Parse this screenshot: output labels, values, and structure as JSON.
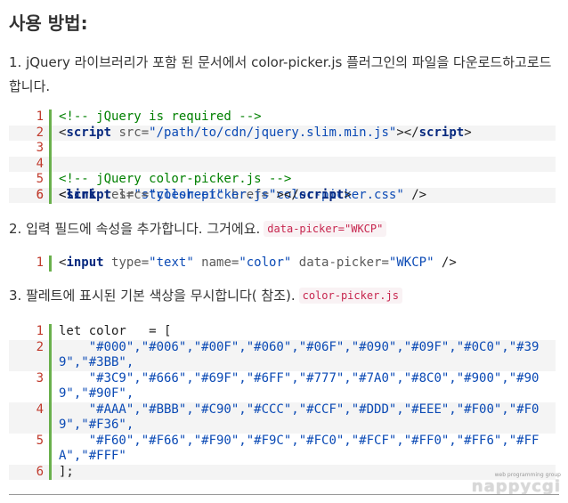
{
  "heading": "사용 방법:",
  "step1": "1. jQuery 라이브러리가 포함 된 문서에서 color-picker.js 플러그인의 파일을 다운로드하고로드합니다.",
  "step2": {
    "text": "2. 입력 필드에 속성을 추가합니다. 그거에요.",
    "code": "data-picker=\"WKCP\""
  },
  "step3": {
    "text": "3. 팔레트에 표시된 기본 색상을 무시합니다( 참조).",
    "code": "color-picker.js"
  },
  "block1": {
    "numbers": [
      "1",
      "2",
      "3",
      "4",
      "5",
      "6"
    ],
    "line1": "<!-- jQuery is required -->",
    "line2": {
      "open": "<",
      "tag": "script",
      "attr": " src=",
      "val": "\"/path/to/cdn/jquery.slim.min.js\"",
      "close": "></",
      "tag2": "script",
      "end": ">"
    },
    "line4": "<!-- jQuery color-picker.js -->",
    "line5": {
      "open": "<",
      "tag": "link",
      "attr1": " rel=",
      "val1": "\"stylesheet\"",
      "attr2": " href=",
      "val2": "\"color-picker.css\"",
      "end": " />"
    },
    "line6": {
      "open": "<",
      "tag": "script",
      "attr": " src=",
      "val": "\"color-picker.js\"",
      "close": "></",
      "tag2": "script",
      "end": ">"
    }
  },
  "block2": {
    "numbers": [
      "1"
    ],
    "line1": {
      "open": "<",
      "tag": "input",
      "a1": " type=",
      "v1": "\"text\"",
      "a2": " name=",
      "v2": "\"color\"",
      "a3": " data-picker=",
      "v3": "\"WKCP\"",
      "end": " />"
    }
  },
  "block3": {
    "numbers": [
      "1",
      "2",
      "3",
      "4",
      "5",
      "6"
    ],
    "lines": [
      "let color   = [",
      "    \"#000\",\"#006\",\"#00F\",\"#060\",\"#06F\",\"#090\",\"#09F\",\"#0C0\",\"#399\",\"#3BB\",",
      "    \"#3C9\",\"#666\",\"#69F\",\"#6FF\",\"#777\",\"#7A0\",\"#8C0\",\"#900\",\"#909\",\"#90F\",",
      "    \"#AAA\",\"#BBB\",\"#C90\",\"#CCC\",\"#CCF\",\"#DDD\",\"#EEE\",\"#F00\",\"#F09\",\"#F36\",",
      "    \"#F60\",\"#F66\",\"#F90\",\"#F9C\",\"#FC0\",\"#FCF\",\"#FF0\",\"#FF6\",\"#FFA\",\"#FFF\"",
      "];"
    ]
  },
  "watermark": {
    "small": "web programming group",
    "big": "nappycgi"
  },
  "colors": {
    "comment": "#008000",
    "keyword": "#06287e",
    "string": "#0b4ab5",
    "line_number": "#c0392b",
    "gutter": "#6ab04c"
  }
}
